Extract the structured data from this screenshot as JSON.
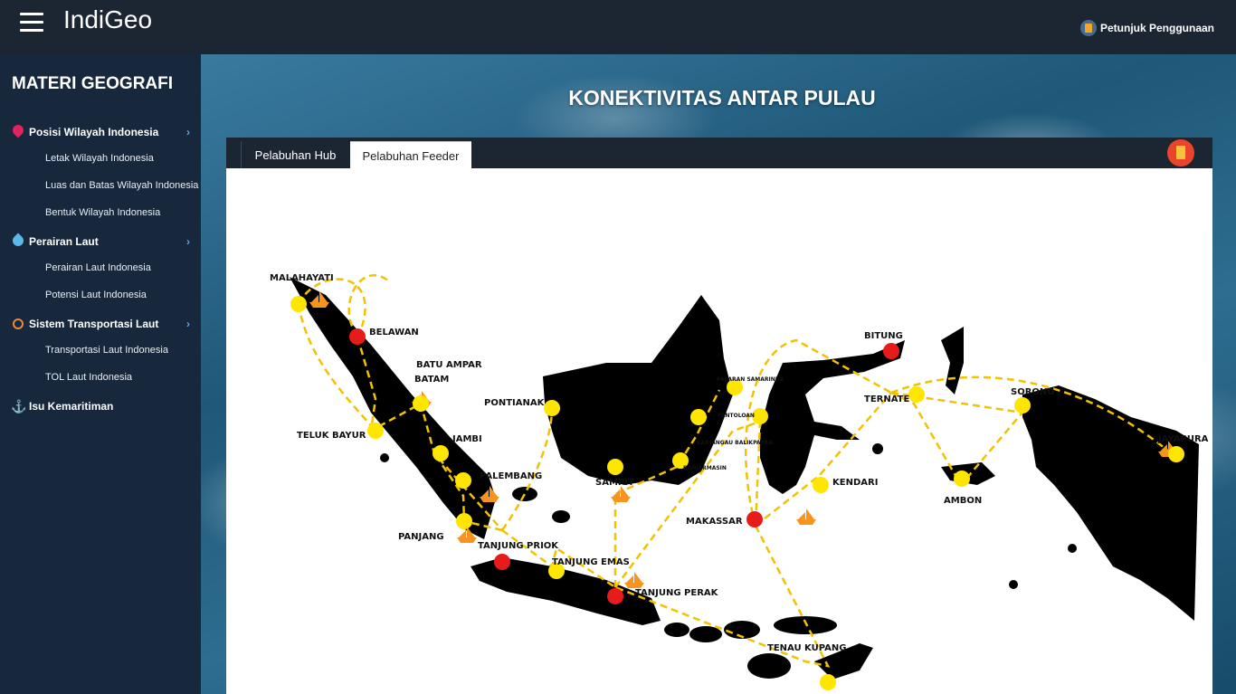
{
  "header": {
    "brand": "IndiGeo",
    "guide_label": "Petunjuk Penggunaan"
  },
  "sidebar": {
    "title": "MATERI GEOGRAFI",
    "sections": [
      {
        "label": "Posisi Wilayah Indonesia",
        "icon": "map-pin-icon",
        "items": [
          "Letak Wilayah Indonesia",
          "Luas dan Batas Wilayah Indonesia",
          "Bentuk Wilayah Indonesia"
        ]
      },
      {
        "label": "Perairan Laut",
        "icon": "water-drop-icon",
        "items": [
          "Perairan Laut Indonesia",
          "Potensi Laut Indonesia"
        ]
      },
      {
        "label": "Sistem Transportasi Laut",
        "icon": "ship-wheel-icon",
        "items": [
          "Transportasi Laut Indonesia",
          "TOL Laut Indonesia"
        ]
      },
      {
        "label": "Isu Kemaritiman",
        "icon": "anchor-icon",
        "items": []
      }
    ]
  },
  "main": {
    "title": "KONEKTIVITAS ANTAR PULAU",
    "tabs": [
      {
        "label": "Pelabuhan Hub",
        "active": false
      },
      {
        "label": "Pelabuhan Feeder",
        "active": true
      }
    ]
  },
  "map": {
    "colors": {
      "hub": "#e81b1b",
      "feeder": "#ffe600",
      "route": "#f2c200",
      "land": "#000000",
      "ship": "#f7941d"
    },
    "hub_ports": [
      "BELAWAN",
      "TANJUNG PRIOK",
      "TANJUNG PERAK",
      "MAKASSAR",
      "BITUNG"
    ],
    "feeder_ports": [
      "MALAHAYATI",
      "BATU AMPAR",
      "BATAM",
      "TELUK BAYUR",
      "JAMBI",
      "PALEMBANG",
      "PANJANG",
      "PONTIANAK",
      "SAMPIT",
      "TANJUNG EMAS",
      "BANJARMASIN",
      "KARIANGAU BALIKPAPAN",
      "PALARAN SAMARINDA",
      "PANTOLOAN",
      "KENDARI",
      "TERNATE",
      "SORONG",
      "AMBON",
      "JAYAPURA",
      "TENAU KUPANG"
    ]
  }
}
